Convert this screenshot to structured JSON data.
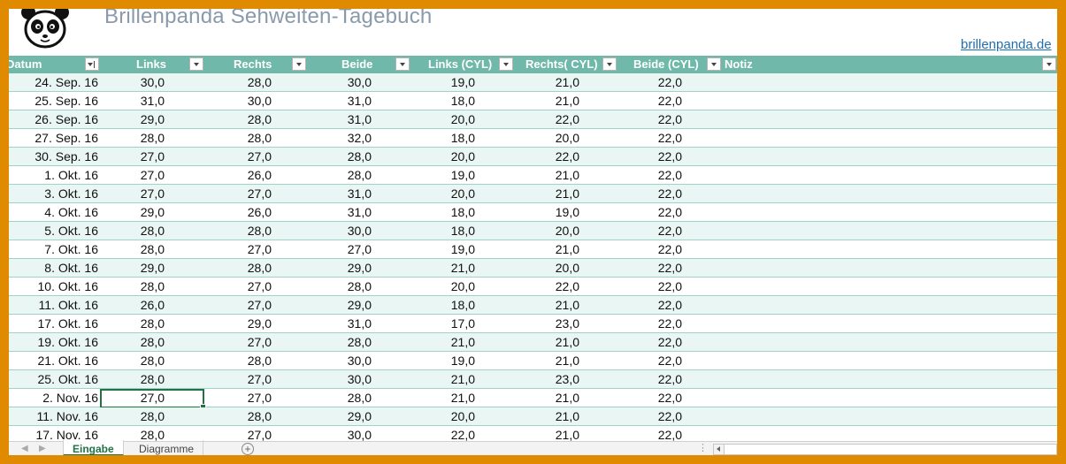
{
  "title": "Brillenpanda Sehweiten-Tagebuch",
  "link": "brillenpanda.de",
  "logo": "panda-logo",
  "colors": {
    "frame": "#E08A00",
    "header": "#6FB8AA",
    "band": "#E9F6F3",
    "link": "#1E6FB3",
    "accent": "#217346"
  },
  "columns": [
    {
      "label": "Datum"
    },
    {
      "label": "Links"
    },
    {
      "label": "Rechts"
    },
    {
      "label": "Beide"
    },
    {
      "label": "Links (CYL)"
    },
    {
      "label": "Rechts( CYL)"
    },
    {
      "label": "Beide (CYL)"
    },
    {
      "label": "Notiz"
    }
  ],
  "rows": [
    {
      "datum": "24. Sep. 16",
      "links": "30,0",
      "rechts": "28,0",
      "beide": "30,0",
      "links_cyl": "19,0",
      "rechts_cyl": "21,0",
      "beide_cyl": "22,0",
      "notiz": ""
    },
    {
      "datum": "25. Sep. 16",
      "links": "31,0",
      "rechts": "30,0",
      "beide": "31,0",
      "links_cyl": "18,0",
      "rechts_cyl": "21,0",
      "beide_cyl": "22,0",
      "notiz": ""
    },
    {
      "datum": "26. Sep. 16",
      "links": "29,0",
      "rechts": "28,0",
      "beide": "31,0",
      "links_cyl": "20,0",
      "rechts_cyl": "22,0",
      "beide_cyl": "22,0",
      "notiz": ""
    },
    {
      "datum": "27. Sep. 16",
      "links": "28,0",
      "rechts": "28,0",
      "beide": "32,0",
      "links_cyl": "18,0",
      "rechts_cyl": "20,0",
      "beide_cyl": "22,0",
      "notiz": ""
    },
    {
      "datum": "30. Sep. 16",
      "links": "27,0",
      "rechts": "27,0",
      "beide": "28,0",
      "links_cyl": "20,0",
      "rechts_cyl": "22,0",
      "beide_cyl": "22,0",
      "notiz": ""
    },
    {
      "datum": "1. Okt. 16",
      "links": "27,0",
      "rechts": "26,0",
      "beide": "28,0",
      "links_cyl": "19,0",
      "rechts_cyl": "21,0",
      "beide_cyl": "22,0",
      "notiz": ""
    },
    {
      "datum": "3. Okt. 16",
      "links": "27,0",
      "rechts": "27,0",
      "beide": "31,0",
      "links_cyl": "20,0",
      "rechts_cyl": "21,0",
      "beide_cyl": "22,0",
      "notiz": ""
    },
    {
      "datum": "4. Okt. 16",
      "links": "29,0",
      "rechts": "26,0",
      "beide": "31,0",
      "links_cyl": "18,0",
      "rechts_cyl": "19,0",
      "beide_cyl": "22,0",
      "notiz": ""
    },
    {
      "datum": "5. Okt. 16",
      "links": "28,0",
      "rechts": "28,0",
      "beide": "30,0",
      "links_cyl": "18,0",
      "rechts_cyl": "20,0",
      "beide_cyl": "22,0",
      "notiz": ""
    },
    {
      "datum": "7. Okt. 16",
      "links": "28,0",
      "rechts": "27,0",
      "beide": "27,0",
      "links_cyl": "19,0",
      "rechts_cyl": "21,0",
      "beide_cyl": "22,0",
      "notiz": ""
    },
    {
      "datum": "8. Okt. 16",
      "links": "29,0",
      "rechts": "28,0",
      "beide": "29,0",
      "links_cyl": "21,0",
      "rechts_cyl": "20,0",
      "beide_cyl": "22,0",
      "notiz": ""
    },
    {
      "datum": "10. Okt. 16",
      "links": "28,0",
      "rechts": "27,0",
      "beide": "28,0",
      "links_cyl": "20,0",
      "rechts_cyl": "22,0",
      "beide_cyl": "22,0",
      "notiz": ""
    },
    {
      "datum": "11. Okt. 16",
      "links": "26,0",
      "rechts": "27,0",
      "beide": "29,0",
      "links_cyl": "18,0",
      "rechts_cyl": "21,0",
      "beide_cyl": "22,0",
      "notiz": ""
    },
    {
      "datum": "17. Okt. 16",
      "links": "28,0",
      "rechts": "29,0",
      "beide": "31,0",
      "links_cyl": "17,0",
      "rechts_cyl": "23,0",
      "beide_cyl": "22,0",
      "notiz": ""
    },
    {
      "datum": "19. Okt. 16",
      "links": "28,0",
      "rechts": "27,0",
      "beide": "28,0",
      "links_cyl": "21,0",
      "rechts_cyl": "21,0",
      "beide_cyl": "22,0",
      "notiz": ""
    },
    {
      "datum": "21. Okt. 16",
      "links": "28,0",
      "rechts": "28,0",
      "beide": "30,0",
      "links_cyl": "19,0",
      "rechts_cyl": "21,0",
      "beide_cyl": "22,0",
      "notiz": ""
    },
    {
      "datum": "25. Okt. 16",
      "links": "28,0",
      "rechts": "27,0",
      "beide": "30,0",
      "links_cyl": "21,0",
      "rechts_cyl": "23,0",
      "beide_cyl": "22,0",
      "notiz": ""
    },
    {
      "datum": "2. Nov. 16",
      "links": "27,0",
      "rechts": "27,0",
      "beide": "28,0",
      "links_cyl": "21,0",
      "rechts_cyl": "21,0",
      "beide_cyl": "22,0",
      "notiz": ""
    },
    {
      "datum": "11. Nov. 16",
      "links": "28,0",
      "rechts": "28,0",
      "beide": "29,0",
      "links_cyl": "20,0",
      "rechts_cyl": "21,0",
      "beide_cyl": "22,0",
      "notiz": ""
    },
    {
      "datum": "17. Nov. 16",
      "links": "28,0",
      "rechts": "27,0",
      "beide": "30,0",
      "links_cyl": "22,0",
      "rechts_cyl": "21,0",
      "beide_cyl": "22,0",
      "notiz": ""
    }
  ],
  "selected_row": 17,
  "tabs": [
    {
      "label": "Eingabe",
      "active": true
    },
    {
      "label": "Diagramme",
      "active": false
    }
  ],
  "add_sheet": "+",
  "icons": [
    "panda-logo",
    "filter-dropdown-icon",
    "sort-filter-icon",
    "add-sheet-icon",
    "scroll-left-icon"
  ]
}
